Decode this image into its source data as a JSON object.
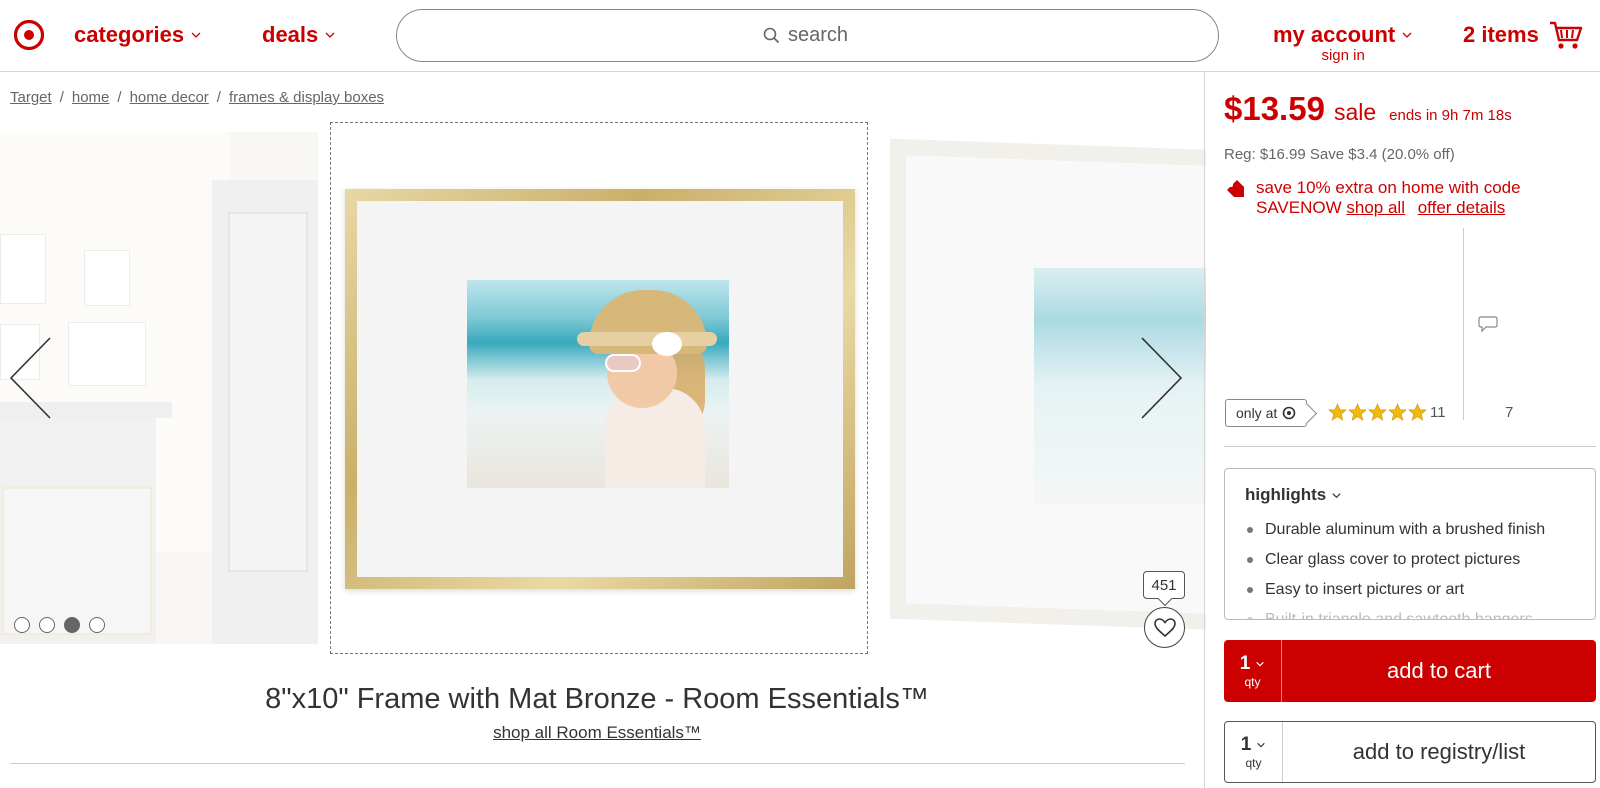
{
  "header": {
    "logo_icon": "target-bullseye-icon",
    "categories_label": "categories",
    "deals_label": "deals",
    "search_placeholder": "search",
    "account_label": "my account",
    "signin_label": "sign in",
    "cart_label": "2 items",
    "brand_color": "#cc0000"
  },
  "breadcrumb": [
    "Target",
    "home",
    "home decor",
    "frames & display boxes"
  ],
  "carousel": {
    "dot_count": 4,
    "active_dot": 3,
    "favorite_count": "451"
  },
  "product": {
    "title": "8\"x10\" Frame with Mat Bronze - Room Essentials™",
    "brand_link": "shop all Room Essentials™",
    "price": "$13.59",
    "sale_label": "sale",
    "sale_ends": "ends in 9h 7m 18s",
    "reg_text": "Reg: $16.99 Save $3.4 (20.0% off)",
    "promo_text": "save 10% extra on home with code SAVENOW",
    "promo_link_shop": "shop all",
    "promo_link_details": "offer details",
    "only_at_label": "only at",
    "rating": 5,
    "rating_count": "11",
    "qa_count": "7"
  },
  "highlights": {
    "heading": "highlights",
    "items": [
      "Durable aluminum with a brushed finish",
      "Clear glass cover to protect pictures",
      "Easy to insert pictures or art",
      "Built-in triangle and sawtooth hangers"
    ]
  },
  "actions": {
    "qty_value": "1",
    "qty_label": "qty",
    "add_to_cart": "add to cart",
    "add_to_registry": "add to registry/list"
  }
}
